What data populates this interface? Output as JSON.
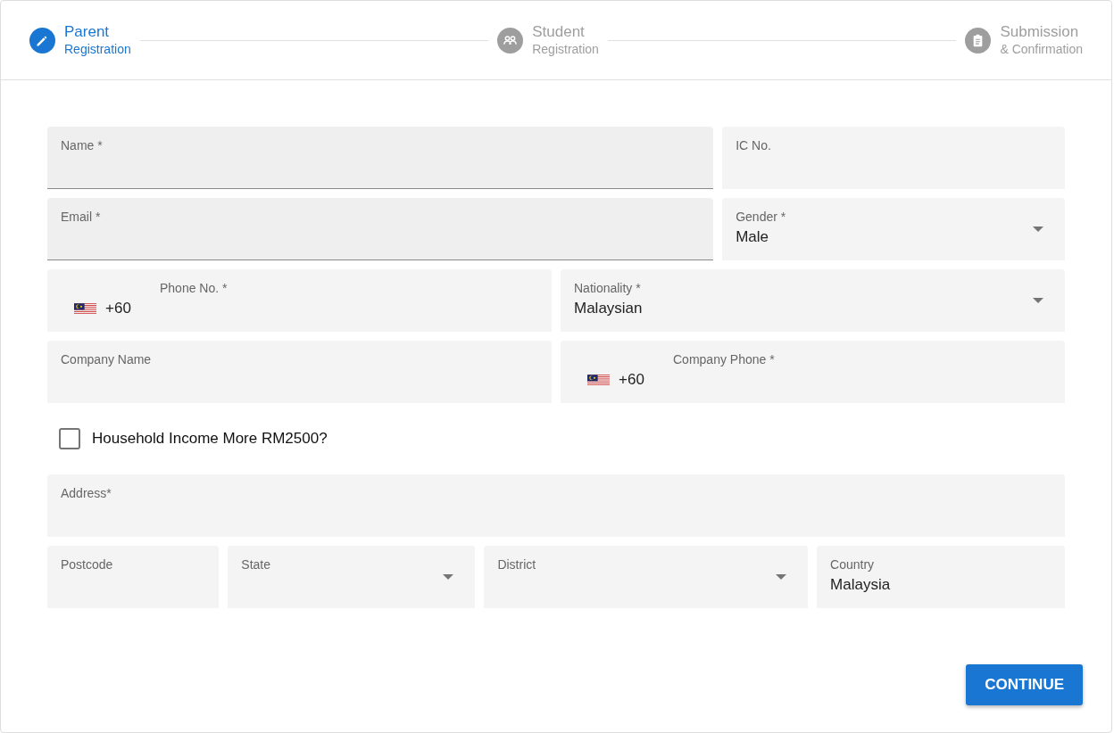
{
  "stepper": [
    {
      "title": "Parent",
      "subtitle": "Registration",
      "selected": true
    },
    {
      "title": "Student",
      "subtitle": "Registration",
      "selected": false
    },
    {
      "title": "Submission",
      "subtitle": "& Confirmation",
      "selected": false
    }
  ],
  "form_rows": [
    [
      {
        "kind": "text",
        "label": "Name *",
        "underlined": true
      },
      {
        "kind": "text",
        "label": "IC No.",
        "underlined": false
      }
    ],
    [
      {
        "kind": "text",
        "label": "Email *",
        "underlined": true
      },
      {
        "kind": "select",
        "label": "Gender *",
        "value": "Male",
        "underlined": false
      }
    ],
    [
      {
        "kind": "phone",
        "label": "Phone No. *",
        "value": "+60",
        "underlined": false
      },
      {
        "kind": "select",
        "label": "Nationality *",
        "value": "Malaysian",
        "underlined": false
      }
    ],
    [
      {
        "kind": "text",
        "label": "Company Name",
        "underlined": false
      },
      {
        "kind": "phone",
        "label": "Company Phone *",
        "value": "+60",
        "underlined": false
      }
    ],
    [
      {
        "kind": "checkbox",
        "label": "Household Income More RM2500?",
        "checked": false
      }
    ],
    [
      {
        "kind": "text",
        "label": "Address*",
        "underlined": false
      }
    ],
    [
      {
        "kind": "text",
        "label": "Postcode",
        "underlined": false
      },
      {
        "kind": "select",
        "label": "State",
        "underlined": false
      },
      {
        "kind": "select",
        "label": "District",
        "underlined": false
      },
      {
        "kind": "text",
        "label": "Country",
        "value": "Malaysia",
        "underlined": false
      }
    ]
  ],
  "continue_button": "CONTINUE"
}
